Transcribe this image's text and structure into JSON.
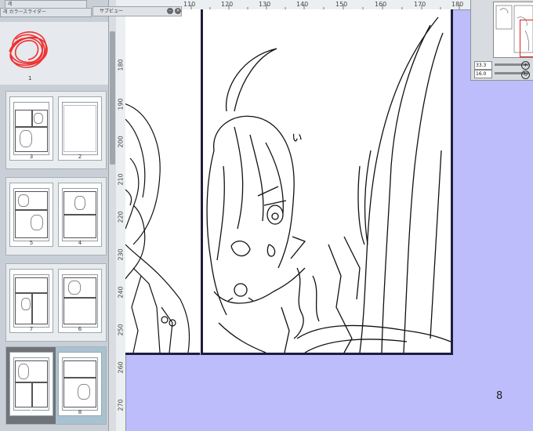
{
  "windows": {
    "layer_tab": "레",
    "layer_tab2": "레",
    "color_tab": "カラースライダー",
    "sub_view_title": "サブビュー"
  },
  "ruler": {
    "top": [
      "110",
      "120",
      "130",
      "140",
      "150",
      "160",
      "170",
      "180"
    ],
    "left": [
      "180",
      "190",
      "200",
      "210",
      "220",
      "230",
      "240",
      "250",
      "260",
      "270"
    ]
  },
  "pages": {
    "cover": {
      "label": "1"
    },
    "spreads": [
      {
        "left": "3",
        "right": "2"
      },
      {
        "left": "5",
        "right": "4"
      },
      {
        "left": "7",
        "right": "6"
      },
      {
        "left": "9",
        "right": "8",
        "selected": true
      }
    ]
  },
  "canvas": {
    "page_number": "8",
    "sfx": "ぃ"
  },
  "navigator": {
    "zoom_value": "33.3",
    "rotate_value": "16.0"
  },
  "colors": {
    "background": "#bdbdfc",
    "frame": "#1e1e40",
    "nav_view": "#e02020",
    "cover_scribble": "#ef3030"
  }
}
